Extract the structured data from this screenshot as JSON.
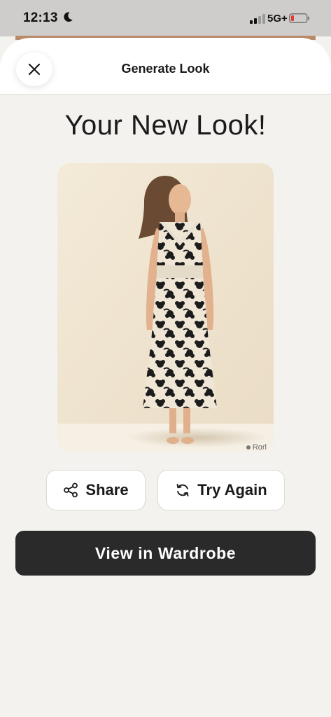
{
  "status_bar": {
    "time": "12:13",
    "network": "5G+",
    "icons": [
      "moon-icon",
      "signal-icon",
      "battery-icon"
    ],
    "battery_color": "#e53935"
  },
  "header": {
    "title": "Generate Look",
    "close_icon": "close-icon"
  },
  "main": {
    "title": "Your New Look!",
    "image_watermark": "Rorl"
  },
  "actions": {
    "share_label": "Share",
    "share_icon": "share-icon",
    "retry_label": "Try Again",
    "retry_icon": "refresh-icon",
    "primary_label": "View in Wardrobe"
  },
  "colors": {
    "background": "#f4f2ee",
    "primary_button": "#2a2a2a",
    "card": "#ffffff"
  }
}
